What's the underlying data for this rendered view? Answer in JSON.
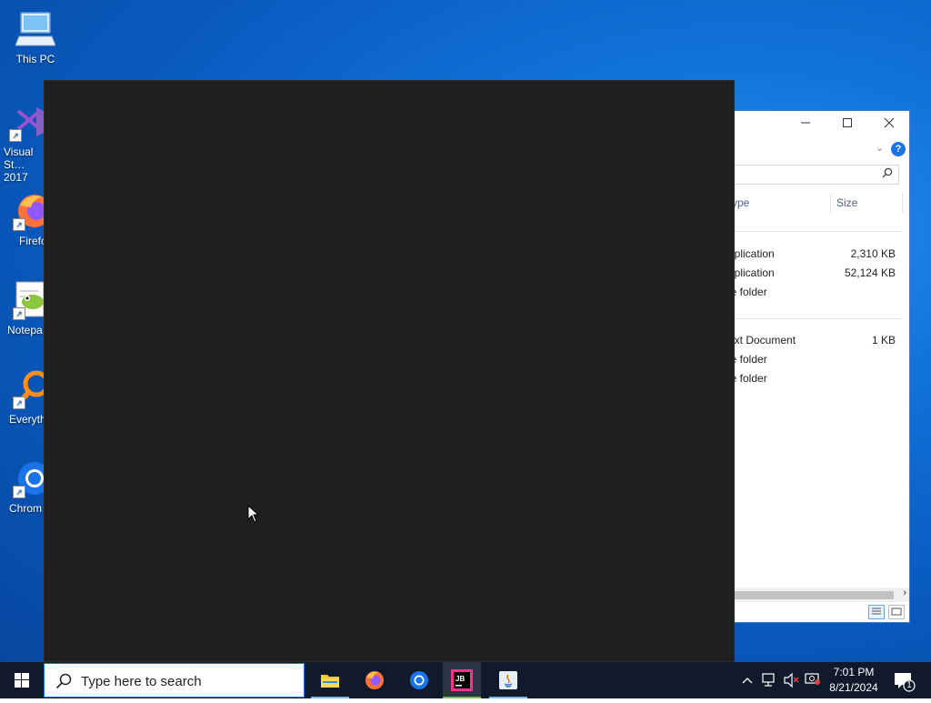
{
  "desktop": {
    "icons": [
      {
        "label": "This PC"
      },
      {
        "label": "Visual St… 2017"
      },
      {
        "label": "Firefo"
      },
      {
        "label": "Notepa"
      },
      {
        "label": "Everyth"
      },
      {
        "label": "Chrom"
      }
    ]
  },
  "explorer": {
    "columns": {
      "type": "ype",
      "size": "Size"
    },
    "rows": [
      {
        "type": "pplication",
        "size": "2,310 KB"
      },
      {
        "type": "pplication",
        "size": "52,124 KB"
      },
      {
        "type": "le folder",
        "size": ""
      },
      {
        "type": "ext Document",
        "size": "1 KB"
      },
      {
        "type": "le folder",
        "size": ""
      },
      {
        "type": "le folder",
        "size": ""
      }
    ],
    "help_label": "?"
  },
  "taskbar": {
    "search_placeholder": "Type here to search",
    "apps": [
      {
        "name": "File Explorer"
      },
      {
        "name": "Firefox"
      },
      {
        "name": "Chrome"
      },
      {
        "name": "JetBrains",
        "glyph_text": "JB"
      },
      {
        "name": "Java"
      }
    ],
    "clock": {
      "time": "7:01 PM",
      "date": "8/21/2024"
    },
    "notification_count": "1"
  },
  "colors": {
    "desktop_blue": "#0a5bc0",
    "dark_window": "#1f1f1f",
    "taskbar": "#101a2a",
    "accent_blue": "#1a73e8"
  }
}
